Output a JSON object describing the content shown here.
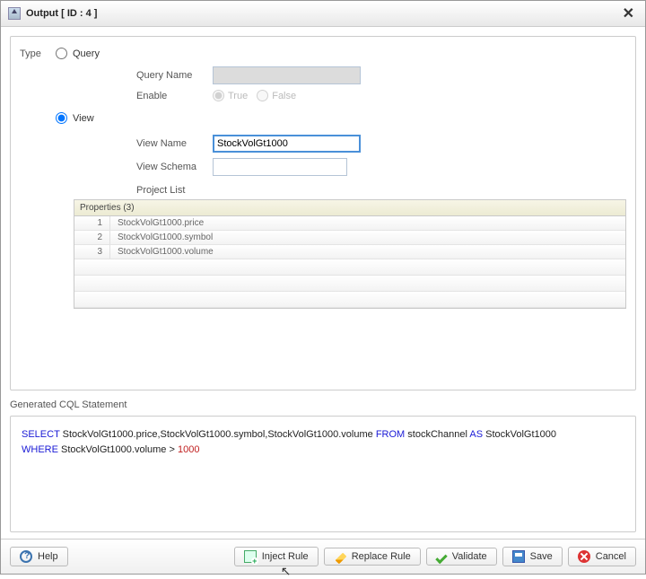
{
  "dialog": {
    "title": "Output [ ID : 4 ]"
  },
  "type_label": "Type",
  "options": {
    "query": "Query",
    "view": "View"
  },
  "query_form": {
    "name_label": "Query Name",
    "name_value": "",
    "enable_label": "Enable",
    "true_label": "True",
    "false_label": "False"
  },
  "view_form": {
    "name_label": "View Name",
    "name_value": "StockVolGt1000",
    "schema_label": "View Schema",
    "schema_value": "",
    "project_list_label": "Project List"
  },
  "table": {
    "header": "Properties (3)",
    "rows": [
      {
        "idx": "1",
        "value": "StockVolGt1000.price"
      },
      {
        "idx": "2",
        "value": "StockVolGt1000.symbol"
      },
      {
        "idx": "3",
        "value": "StockVolGt1000.volume"
      }
    ]
  },
  "generated": {
    "label": "Generated CQL Statement",
    "cql": {
      "select": "SELECT",
      "cols": "StockVolGt1000.price,StockVolGt1000.symbol,StockVolGt1000.volume",
      "from": "FROM",
      "source": "stockChannel",
      "as": "AS",
      "alias": "StockVolGt1000",
      "where": "WHERE",
      "cond": "StockVolGt1000.volume >",
      "val": "1000"
    }
  },
  "buttons": {
    "help": "Help",
    "inject": "Inject Rule",
    "replace": "Replace Rule",
    "validate": "Validate",
    "save": "Save",
    "cancel": "Cancel"
  }
}
